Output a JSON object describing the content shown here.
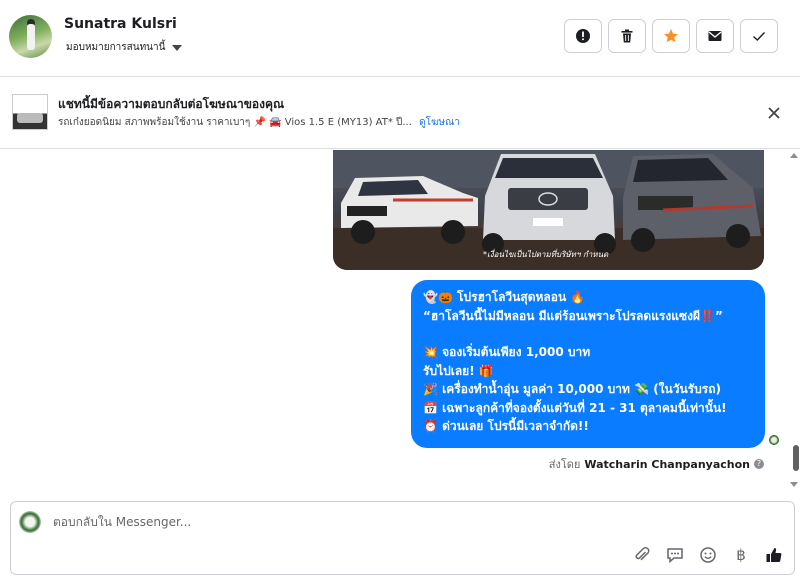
{
  "header": {
    "user_name": "Sunatra Kulsri",
    "assign_label": "มอบหมายการสนทนานี้",
    "actions": [
      {
        "name": "report-button",
        "icon": "alert-icon"
      },
      {
        "name": "delete-button",
        "icon": "trash-icon"
      },
      {
        "name": "star-button",
        "icon": "star-icon"
      },
      {
        "name": "mark-unread-button",
        "icon": "envelope-icon"
      },
      {
        "name": "done-button",
        "icon": "check-icon"
      }
    ]
  },
  "ad": {
    "title": "แชทนี้มีข้อความตอบกลับต่อโฆษณาของคุณ",
    "description": "รถเก๋งยอดนิยม สภาพพร้อมใช้งาน ราคาเบาๆ 📌 🚘 Vios 1.5 E (MY13) AT* ปี...",
    "link_label": "ดูโฆษณา"
  },
  "chat": {
    "image_caption": "*เงื่อนไขเป็นไปตามที่บริษัทฯ กำหนด",
    "message_lines": [
      "👻🎃 โปรฮาโลวีนสุดหลอน 🔥",
      "“ฮาโลวีนนี้ไม่มีหลอน มีแต่ร้อนเพราะโปรลดแรงแซงผี‼️”",
      "",
      "💥 จองเริ่มต้นเพียง 1,000 บาท",
      "รับไปเลย! 🎁",
      "🎉 เครื่องทำน้ำอุ่น มูลค่า 10,000 บาท 💸 (ในวันรับรถ)",
      "📅 เฉพาะลูกค้าที่จองตั้งแต่วันที่ 21 - 31 ตุลาคมนี้เท่านั้น!",
      "⏰ ด่วนเลย โปรนี้มีเวลาจำกัด!!"
    ],
    "sent_by_prefix": "ส่งโดย",
    "sent_by_name": "Watcharin Chanpanyachon",
    "sent_by_help": "?"
  },
  "composer": {
    "placeholder": "ตอบกลับใน Messenger...",
    "baht_symbol": "฿"
  },
  "colors": {
    "bubble": "#0a7cff",
    "accent_link": "#1b74e4",
    "star": "#f7922a"
  }
}
